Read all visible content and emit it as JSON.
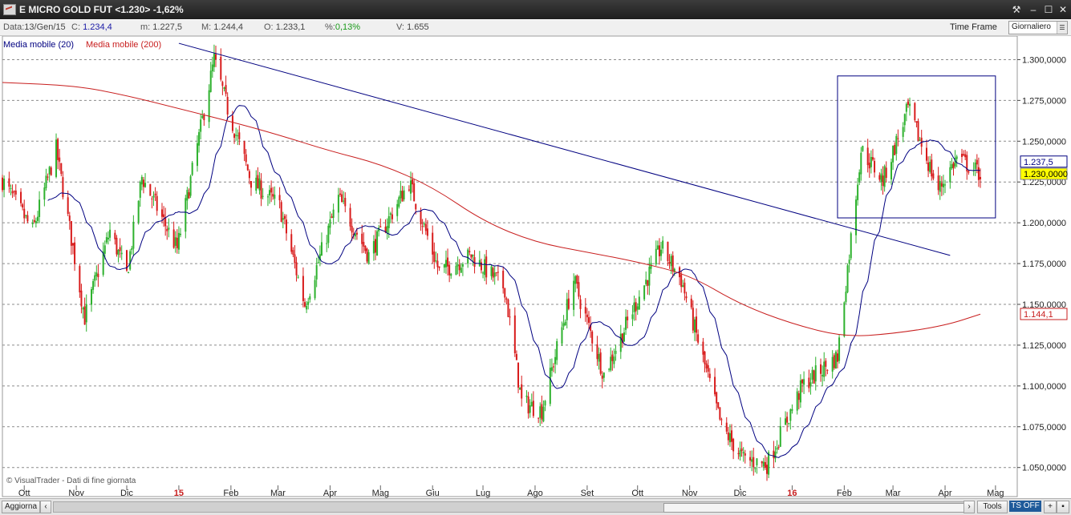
{
  "window": {
    "title": "E MICRO GOLD FUT <1.230> -1,62%",
    "controls": [
      "⚒",
      "–",
      "☐",
      "✕"
    ]
  },
  "info": {
    "date_label": "Data:",
    "date_value": "13/Gen/15",
    "close_label": "C:",
    "close_value": "1.234,4",
    "min_label": "m:",
    "min_value": "1.227,5",
    "max_label": "M:",
    "max_value": "1.244,4",
    "open_label": "O:",
    "open_value": "1.233,1",
    "pct_label": "%:",
    "pct_value": "0,13%",
    "vol_label": "V:",
    "vol_value": "1.655",
    "timeframe_label": "Time Frame",
    "timeframe_value": "Giornaliero"
  },
  "legend": {
    "ma20": "Media mobile (20)",
    "ma200": "Media mobile (200)"
  },
  "watermark": "© VisualTrader - Dati di fine giornata",
  "bottom": {
    "update_label": "Aggiorna",
    "tools_label": "Tools",
    "tsoff_label": "TS OFF",
    "plus_label": "+"
  },
  "colors": {
    "up": "#2db12d",
    "down": "#d81b1b",
    "ma20": "#000080",
    "ma200": "#c81e1e",
    "trendline": "#000080",
    "highlight_box": "#000080",
    "current_price_bg": "#ffff00"
  },
  "chart_data": {
    "type": "candlestick",
    "y_axis_labels": [
      "1.300,0000",
      "1.275,0000",
      "1.250,0000",
      "1.225,0000",
      "1.200,0000",
      "1.175,0000",
      "1.150,0000",
      "1.125,0000",
      "1.100,0000",
      "1.075,0000",
      "1.050,0000"
    ],
    "y_axis_values": [
      1300,
      1275,
      1250,
      1225,
      1200,
      1175,
      1150,
      1125,
      1100,
      1075,
      1050
    ],
    "ylim": [
      1042,
      1312
    ],
    "x_axis_labels": [
      "Ott",
      "Nov",
      "Dic",
      "15",
      "Feb",
      "Mar",
      "Apr",
      "Mag",
      "Giu",
      "Lug",
      "Ago",
      "Set",
      "Ott",
      "Nov",
      "Dic",
      "16",
      "Feb",
      "Mar",
      "Apr",
      "Mag"
    ],
    "x_axis_dates": [
      "2014-10-01",
      "2014-11-01",
      "2014-12-01",
      "2015-01-01",
      "2015-02-01",
      "2015-03-01",
      "2015-04-01",
      "2015-05-01",
      "2015-06-01",
      "2015-07-01",
      "2015-08-01",
      "2015-09-01",
      "2015-10-01",
      "2015-11-01",
      "2015-12-01",
      "2016-01-01",
      "2016-02-01",
      "2016-03-01",
      "2016-04-01",
      "2016-05-01"
    ],
    "date_range": [
      "2014-09-18",
      "2016-04-22"
    ],
    "price_path": [
      [
        "2014-09-18",
        1226
      ],
      [
        "2014-10-06",
        1195
      ],
      [
        "2014-10-20",
        1245
      ],
      [
        "2014-11-06",
        1142
      ],
      [
        "2014-11-21",
        1195
      ],
      [
        "2014-12-01",
        1168
      ],
      [
        "2014-12-10",
        1228
      ],
      [
        "2014-12-31",
        1184
      ],
      [
        "2015-01-22",
        1300
      ],
      [
        "2015-01-30",
        1270
      ],
      [
        "2015-02-13",
        1226
      ],
      [
        "2015-03-02",
        1210
      ],
      [
        "2015-03-17",
        1150
      ],
      [
        "2015-04-06",
        1215
      ],
      [
        "2015-04-24",
        1180
      ],
      [
        "2015-05-18",
        1225
      ],
      [
        "2015-06-05",
        1170
      ],
      [
        "2015-06-24",
        1180
      ],
      [
        "2015-07-14",
        1160
      ],
      [
        "2015-07-24",
        1090
      ],
      [
        "2015-08-05",
        1085
      ],
      [
        "2015-08-24",
        1165
      ],
      [
        "2015-09-11",
        1107
      ],
      [
        "2015-10-15",
        1185
      ],
      [
        "2015-10-27",
        1165
      ],
      [
        "2015-11-20",
        1075
      ],
      [
        "2015-12-03",
        1055
      ],
      [
        "2015-12-17",
        1052
      ],
      [
        "2016-01-07",
        1100
      ],
      [
        "2016-01-28",
        1118
      ],
      [
        "2016-02-11",
        1245
      ],
      [
        "2016-02-24",
        1226
      ],
      [
        "2016-03-10",
        1270
      ],
      [
        "2016-03-28",
        1220
      ],
      [
        "2016-04-08",
        1240
      ],
      [
        "2016-04-22",
        1230
      ]
    ],
    "trendline": {
      "from": [
        "2015-01-01",
        1310
      ],
      "to": [
        "2016-04-04",
        1180
      ]
    },
    "highlight_box": {
      "x": [
        "2016-01-28",
        "2016-05-01"
      ],
      "y": [
        1203,
        1290
      ]
    },
    "ma200_path": [
      [
        "2014-09-18",
        1286
      ],
      [
        "2014-11-01",
        1284
      ],
      [
        "2014-12-01",
        1278
      ],
      [
        "2015-01-01",
        1270
      ],
      [
        "2015-02-01",
        1262
      ],
      [
        "2015-03-01",
        1254
      ],
      [
        "2015-04-01",
        1244
      ],
      [
        "2015-05-01",
        1236
      ],
      [
        "2015-06-01",
        1222
      ],
      [
        "2015-07-01",
        1201
      ],
      [
        "2015-08-01",
        1188
      ],
      [
        "2015-09-01",
        1182
      ],
      [
        "2015-10-01",
        1176
      ],
      [
        "2015-11-01",
        1168
      ],
      [
        "2015-12-01",
        1150
      ],
      [
        "2016-01-01",
        1138
      ],
      [
        "2016-02-01",
        1130
      ],
      [
        "2016-03-01",
        1132
      ],
      [
        "2016-04-01",
        1137
      ],
      [
        "2016-04-22",
        1144
      ]
    ],
    "price_labels": [
      {
        "label": "1.237,5",
        "value": 1237.5,
        "style": "ma20"
      },
      {
        "label": "1.230,0000",
        "value": 1230.0,
        "style": "current"
      },
      {
        "label": "1.144,1",
        "value": 1144.1,
        "style": "ma200"
      }
    ],
    "grid": "horizontal dashed"
  }
}
